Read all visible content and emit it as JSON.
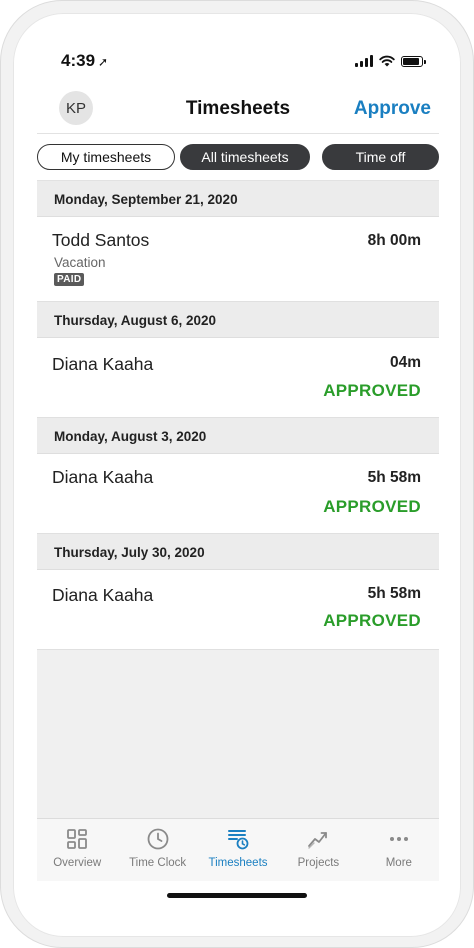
{
  "status_bar": {
    "time": "4:39",
    "location_glyph": "➚"
  },
  "header": {
    "avatar_initials": "KP",
    "title": "Timesheets",
    "action_label": "Approve"
  },
  "filters": {
    "my_timesheets": "My timesheets",
    "all_timesheets": "All timesheets",
    "time_off": "Time off"
  },
  "groups": [
    {
      "date": "Monday, September 21, 2020",
      "entries": [
        {
          "name": "Todd Santos",
          "duration": "8h 00m",
          "type": "Vacation",
          "badge": "PAID"
        }
      ]
    },
    {
      "date": "Thursday, August 6, 2020",
      "entries": [
        {
          "name": "Diana Kaaha",
          "duration": "04m",
          "status": "APPROVED"
        }
      ]
    },
    {
      "date": "Monday, August 3, 2020",
      "entries": [
        {
          "name": "Diana Kaaha",
          "duration": "5h 58m",
          "status": "APPROVED"
        }
      ]
    },
    {
      "date": "Thursday, July 30, 2020",
      "entries": [
        {
          "name": "Diana Kaaha",
          "duration": "5h 58m",
          "status": "APPROVED"
        }
      ]
    }
  ],
  "tabs": [
    {
      "label": "Overview",
      "icon": "overview-grid-icon",
      "active": false
    },
    {
      "label": "Time Clock",
      "icon": "clock-icon",
      "active": false
    },
    {
      "label": "Timesheets",
      "icon": "timesheets-icon",
      "active": true
    },
    {
      "label": "Projects",
      "icon": "projects-chart-icon",
      "active": false
    },
    {
      "label": "More",
      "icon": "more-dots-icon",
      "active": false
    }
  ],
  "colors": {
    "accent": "#1a7fc1",
    "approved": "#2a9d2a",
    "filter_dark": "#393a3d"
  }
}
